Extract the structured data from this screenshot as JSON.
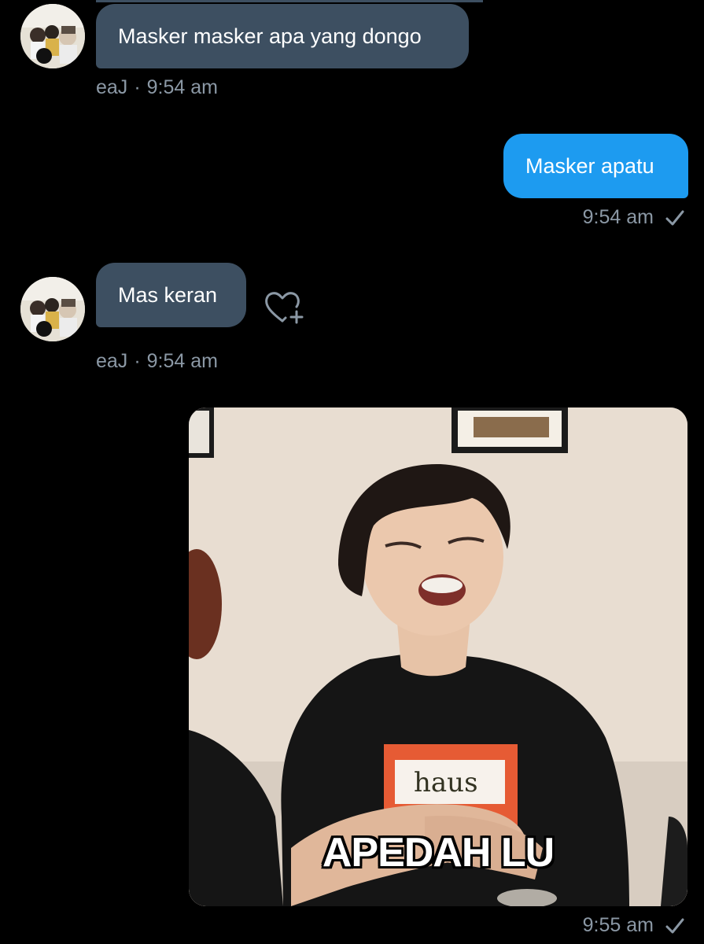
{
  "messages": [
    {
      "sender": "eaJ",
      "time": "9:54 am",
      "text": "Masker masker apa yang dongo"
    },
    {
      "time": "9:54 am",
      "text": "Masker apatu"
    },
    {
      "sender": "eaJ",
      "time": "9:54 am",
      "text": "Mas keran"
    },
    {
      "time": "9:55 am",
      "image_caption": "APEDAH LU",
      "shirt_text": "haus"
    }
  ],
  "separator": "·",
  "icons": {
    "read_receipt": "check-icon",
    "react": "heart-plus-icon"
  },
  "colors": {
    "background": "#000000",
    "incoming_bubble": "#3d4f61",
    "outgoing_bubble": "#1d9bf0",
    "meta_text": "#8b98a5"
  }
}
